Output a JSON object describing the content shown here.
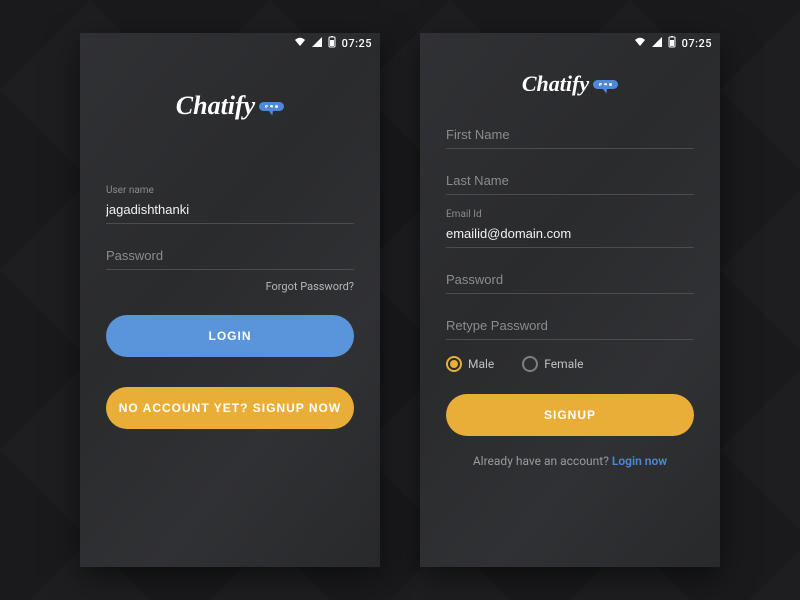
{
  "status": {
    "time": "07:25"
  },
  "brand": {
    "name": "Chatify"
  },
  "login": {
    "username_label": "User name",
    "username_value": "jagadishthanki",
    "password_label": "Password",
    "forgot": "Forgot Password?",
    "login_btn": "LOGIN",
    "signup_btn": "NO ACCOUNT YET? SIGNUP NOW"
  },
  "signup": {
    "first_name": "First Name",
    "last_name": "Last Name",
    "email_label": "Email Id",
    "email_value": "emailid@domain.com",
    "password": "Password",
    "retype": "Retype Password",
    "gender": {
      "male": "Male",
      "female": "Female",
      "selected": "male"
    },
    "signup_btn": "SIGNUP",
    "already_text": "Already have an account? ",
    "login_link": "Login now"
  }
}
